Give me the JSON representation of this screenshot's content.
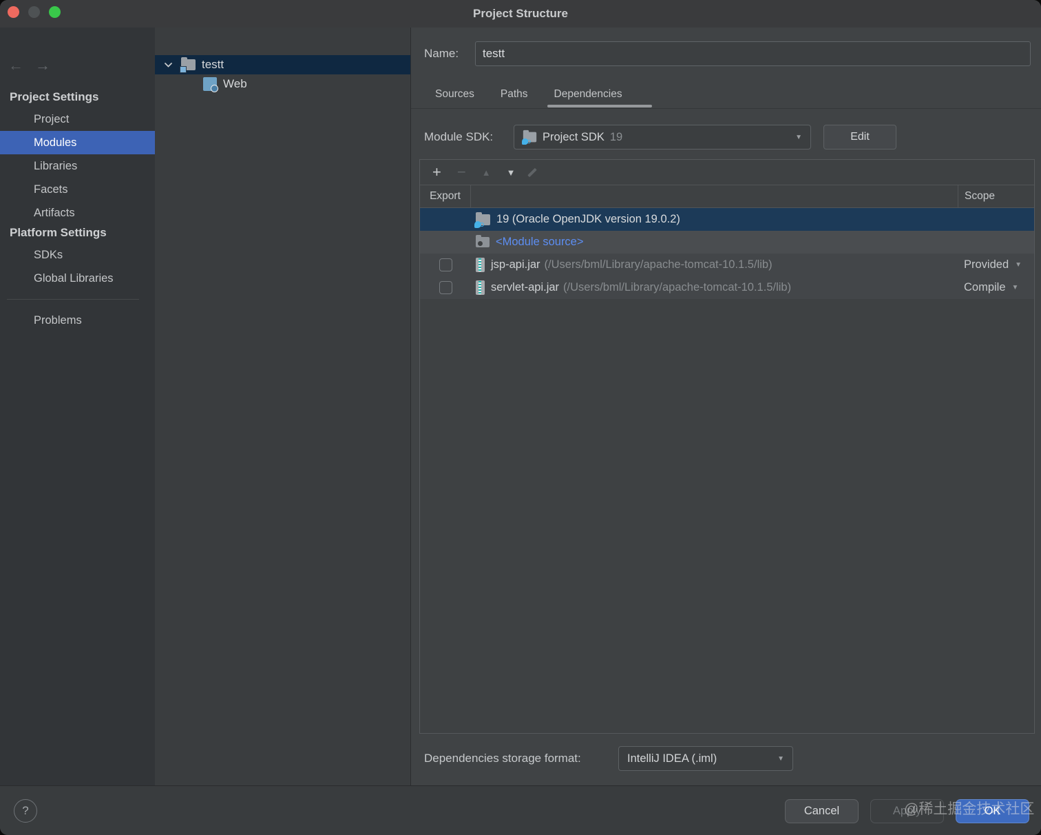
{
  "window": {
    "title": "Project Structure"
  },
  "icons": {
    "back": "←",
    "forward": "→",
    "add": "+",
    "remove": "−",
    "move_up": "▲",
    "move_down": "▼",
    "dropdown_caret": "▼",
    "help": "?"
  },
  "sidebar": {
    "section1_header": "Project Settings",
    "items1": [
      "Project",
      "Modules",
      "Libraries",
      "Facets",
      "Artifacts"
    ],
    "selected_item": "Modules",
    "section2_header": "Platform Settings",
    "items2": [
      "SDKs",
      "Global Libraries"
    ],
    "problems": "Problems"
  },
  "tree": {
    "root_label": "testt",
    "child_label": "Web"
  },
  "name_row": {
    "label": "Name:",
    "value": "testt"
  },
  "tabs": {
    "items": [
      "Sources",
      "Paths",
      "Dependencies"
    ],
    "active": "Dependencies"
  },
  "module_sdk": {
    "label": "Module SDK:",
    "sdk_name": "Project SDK",
    "sdk_version": "19",
    "edit": "Edit"
  },
  "deps": {
    "export_col": "Export",
    "scope_col": "Scope",
    "rows": [
      {
        "type": "sdk",
        "text": "19 (Oracle OpenJDK version 19.0.2)",
        "selected": true
      },
      {
        "type": "module-source",
        "text": "<Module source>"
      },
      {
        "type": "library",
        "name": "jsp-api.jar",
        "path": "(/Users/bml/Library/apache-tomcat-10.1.5/lib)",
        "scope": "Provided",
        "export_checked": false
      },
      {
        "type": "library",
        "name": "servlet-api.jar",
        "path": "(/Users/bml/Library/apache-tomcat-10.1.5/lib)",
        "scope": "Compile",
        "export_checked": false
      }
    ]
  },
  "storage": {
    "label": "Dependencies storage format:",
    "value": "IntelliJ IDEA (.iml)"
  },
  "footer": {
    "cancel": "Cancel",
    "apply": "Apply",
    "ok": "OK",
    "watermark": "@稀土掘金技术社区"
  },
  "colors": {
    "sidebar_selection": "#3d63b5",
    "table_selection": "#1c3a58",
    "tree_selection": "#0f2841",
    "link_blue": "#5d8ef2",
    "ok_button": "#3e6bc0"
  }
}
